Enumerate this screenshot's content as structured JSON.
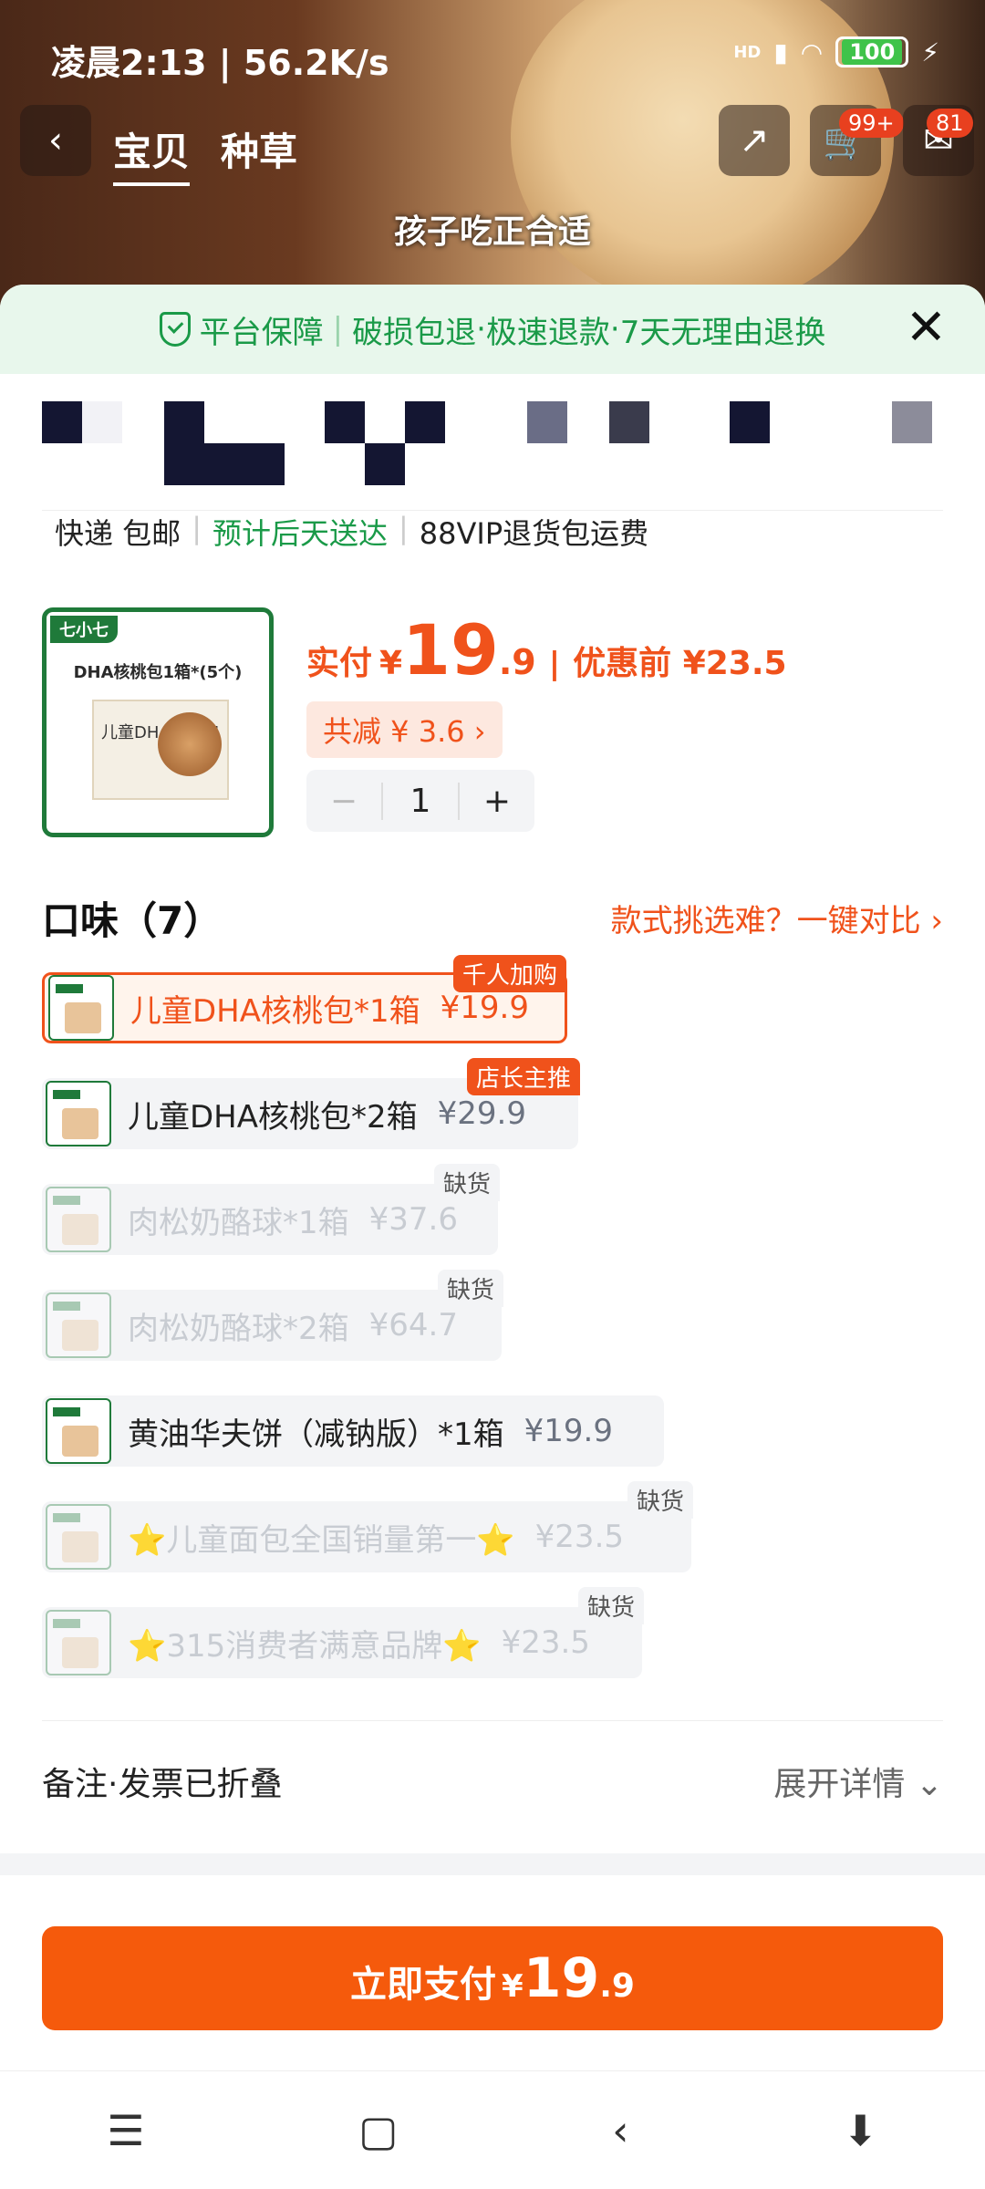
{
  "status": {
    "time": "凌晨2:13 | 56.2K/s",
    "net": "HD",
    "battery": "100"
  },
  "nav": {
    "tabs": [
      "宝贝",
      "种草"
    ],
    "cart_badge": "99+",
    "msg_badge": "81"
  },
  "caption": "孩子吃正合适",
  "guarantee": {
    "title": "平台保障",
    "items": [
      "破损包退",
      "极速退款",
      "7天无理由退换"
    ]
  },
  "shipping": {
    "method": "快递 包邮",
    "eta": "预计后天送达",
    "vip": "88VIP退货包运费"
  },
  "product": {
    "logo": "七小七",
    "box_title": "DHA核桃包1箱*(5个)",
    "box_label": "儿童DHA核桃包"
  },
  "price": {
    "pay_label": "实付",
    "yen": "¥",
    "int": "19",
    "dec": ".9",
    "before": "优惠前 ¥23.5",
    "reduce": "共减 ¥ 3.6 ›"
  },
  "stepper": {
    "minus": "−",
    "qty": "1",
    "plus": "+"
  },
  "flavors": {
    "title": "口味（7）",
    "compare": "款式挑选难？一键对比 ›",
    "options": [
      {
        "name": "儿童DHA核桃包*1箱",
        "price": "¥19.9",
        "tag": "千人加购"
      },
      {
        "name": "儿童DHA核桃包*2箱",
        "price": "¥29.9",
        "tag": "店长主推"
      },
      {
        "name": "肉松奶酪球*1箱",
        "price": "¥37.6",
        "tag": "缺货"
      },
      {
        "name": "肉松奶酪球*2箱",
        "price": "¥64.7",
        "tag": "缺货"
      },
      {
        "name": "黄油华夫饼（减钠版）*1箱",
        "price": "¥19.9",
        "tag": ""
      },
      {
        "name": "⭐儿童面包全国销量第一⭐",
        "price": "¥23.5",
        "tag": "缺货"
      },
      {
        "name": "⭐315消费者满意品牌⭐",
        "price": "¥23.5",
        "tag": "缺货"
      }
    ]
  },
  "note": {
    "label": "备注·发票已折叠",
    "expand": "展开详情 ⌄"
  },
  "pay_button": {
    "label": "立即支付",
    "yen": "¥",
    "int": "19",
    "dec": ".9"
  },
  "sysnav": {
    "menu": "☰",
    "home": "▢",
    "back": "‹",
    "assist": "⬇"
  }
}
